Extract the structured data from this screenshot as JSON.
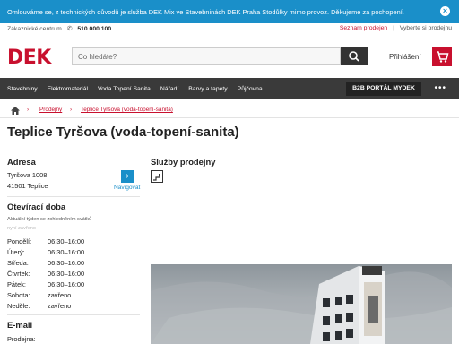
{
  "banner": {
    "text": "Omlouváme se, z technických důvodů je služba DEK Mix ve Stavebninách DEK Praha Stodůlky mimo provoz. Děkujeme za pochopení.",
    "close_icon": "close-icon"
  },
  "topbar": {
    "customer_center_label": "Zákaznické centrum",
    "phone": "510 000 100",
    "store_list_link": "Seznam prodejen",
    "pick_store_link": "Vyberte si prodejnu"
  },
  "header": {
    "logo": "DEK",
    "search_placeholder": "Co hledáte?",
    "login_label": "Přihlášení",
    "brand_color": "#c8102e"
  },
  "nav": {
    "items": [
      "Stavebniny",
      "Elektromateriál",
      "Voda Topení Sanita",
      "Nářadí",
      "Barvy a tapety",
      "Půjčovna"
    ],
    "b2b_label": "B2B PORTÁL MYDEK",
    "more_label": "•••"
  },
  "breadcrumb": {
    "items": [
      "Prodejny",
      "Teplice Tyršova (voda-topení-sanita)"
    ]
  },
  "page": {
    "title": "Teplice Tyršova (voda-topení-sanita)",
    "address_heading": "Adresa",
    "address_line1": "Tyršova 1008",
    "address_line2": "41501 Teplice",
    "navigate_label": "Navigovat",
    "services_heading": "Služby prodejny",
    "hours_heading": "Otevírací doba",
    "hours_note": "Aktuální týden se zohledněním svátků",
    "status_now": "nyní zavřeno",
    "hours": [
      {
        "day": "Pondělí:",
        "time": "06:30–16:00"
      },
      {
        "day": "Úterý:",
        "time": "06:30–16:00"
      },
      {
        "day": "Středa:",
        "time": "06:30–16:00"
      },
      {
        "day": "Čtvrtek:",
        "time": "06:30–16:00"
      },
      {
        "day": "Pátek:",
        "time": "06:30–16:00"
      },
      {
        "day": "Sobota:",
        "time": "zavřeno"
      },
      {
        "day": "Neděle:",
        "time": "zavřeno"
      }
    ],
    "email_heading": "E-mail",
    "email_store_label": "Prodejna:"
  }
}
